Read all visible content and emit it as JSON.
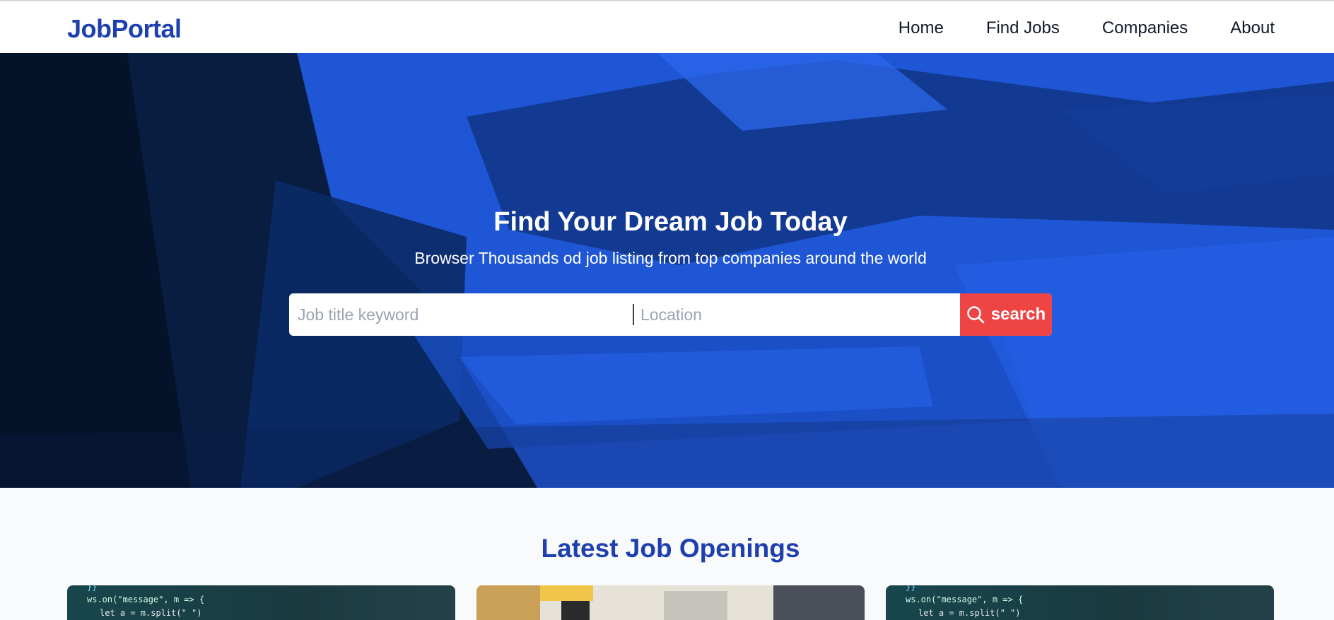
{
  "header": {
    "logo": "JobPortal",
    "nav": [
      "Home",
      "Find Jobs",
      "Companies",
      "About"
    ]
  },
  "hero": {
    "title": "Find Your Dream Job Today",
    "subtitle": "Browser Thousands od job listing from top companies around the world",
    "keyword_placeholder": "Job title keyword",
    "location_placeholder": "Location",
    "search_label": "search"
  },
  "jobs": {
    "title": "Latest Job Openings"
  },
  "colors": {
    "brand": "#1e40af",
    "hero_blue": "#235fe0",
    "search_button": "#ef4444"
  },
  "icons": {
    "search": "search-icon"
  }
}
